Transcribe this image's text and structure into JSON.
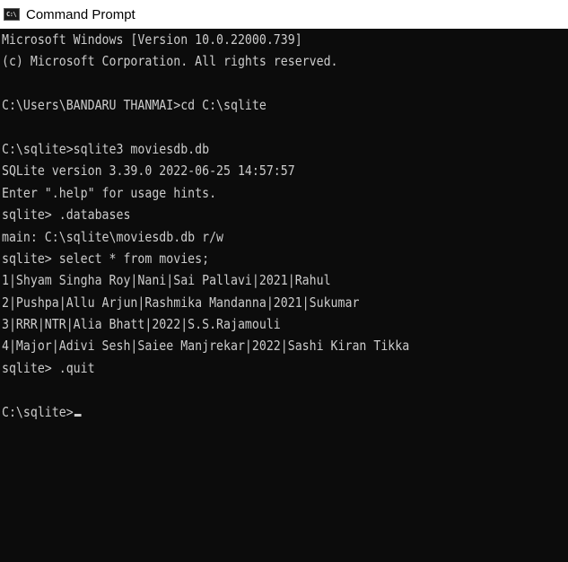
{
  "window": {
    "title": "Command Prompt",
    "icon": "cmd-icon",
    "icon_text": "C:\\"
  },
  "console": {
    "lines": [
      "Microsoft Windows [Version 10.0.22000.739]",
      "(c) Microsoft Corporation. All rights reserved.",
      "",
      "C:\\Users\\BANDARU THANMAI>cd C:\\sqlite",
      "",
      "C:\\sqlite>sqlite3 moviesdb.db",
      "SQLite version 3.39.0 2022-06-25 14:57:57",
      "Enter \".help\" for usage hints.",
      "sqlite> .databases",
      "main: C:\\sqlite\\moviesdb.db r/w",
      "sqlite> select * from movies;",
      "1|Shyam Singha Roy|Nani|Sai Pallavi|2021|Rahul",
      "2|Pushpa|Allu Arjun|Rashmika Mandanna|2021|Sukumar",
      "3|RRR|NTR|Alia Bhatt|2022|S.S.Rajamouli",
      "4|Major|Adivi Sesh|Saiee Manjrekar|2022|Sashi Kiran Tikka",
      "sqlite> .quit",
      "",
      "C:\\sqlite>"
    ]
  },
  "colors": {
    "console_background": "#0c0c0c",
    "console_text": "#cccccc",
    "titlebar_background": "#ffffff"
  }
}
